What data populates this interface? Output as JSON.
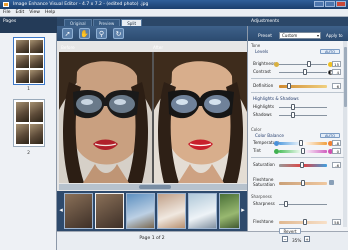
{
  "window": {
    "title": "Image Enhance Visual Editor - 4.7 x 7.2 - (edited photo) .jpg"
  },
  "menu": {
    "items": [
      "File",
      "Edit",
      "View",
      "Help"
    ]
  },
  "pages": {
    "header": "Pages",
    "thumb_numbers": [
      "1",
      "2"
    ]
  },
  "tabs": {
    "items": [
      "Original",
      "Preview",
      "Split"
    ],
    "active": 2
  },
  "toolbar": {
    "icons": [
      "pointer-icon",
      "hand-icon",
      "zoom-icon",
      "rotate-icon"
    ]
  },
  "canvas": {
    "before_label": "Before",
    "after_label": "After"
  },
  "status": {
    "page_info": "Page 1 of 2"
  },
  "adjustments": {
    "header": "Adjustments",
    "preset_label": "Preset",
    "preset_value": "Custom",
    "apply_all": "Apply to",
    "auto_label": "AUTO",
    "sections": {
      "tone": "Tone",
      "levels": "Levels",
      "highlights": "Highlights & Shadows",
      "color": "Color",
      "color_balance": "Color Balance",
      "sharpness": "Sharpness"
    },
    "rows": {
      "brightness": {
        "label": "Brightness",
        "value": "15",
        "level": 0.62
      },
      "contrast": {
        "label": "Contrast",
        "value": "4",
        "level": 0.54
      },
      "definition": {
        "label": "Definition",
        "value": "6",
        "level": 0.2
      },
      "highlights": {
        "label": "Highlights",
        "value": "",
        "level": 0.3
      },
      "shadows": {
        "label": "Shadows",
        "value": "",
        "level": 0.3
      },
      "temperature": {
        "label": "Temperature",
        "value": "-8",
        "level": 0.45
      },
      "tint": {
        "label": "Tint",
        "value": "0",
        "level": 0.5
      },
      "saturation": {
        "label": "Saturation",
        "value": "-6",
        "level": 0.47
      },
      "flesh_saturation": {
        "label": "Fleshtone Saturation",
        "value": "",
        "level": 0.5
      },
      "sharpness": {
        "label": "Sharpness",
        "value": "",
        "level": 0.15
      },
      "fleshtone": {
        "label": "Fleshtone",
        "value": "58",
        "level": 0.55
      }
    },
    "revert_label": "Revert",
    "zoom": "35%"
  },
  "colors": {
    "title_bar": "#2f5f9a",
    "panel_header": "#2b4768",
    "accent": "#f0a030"
  }
}
